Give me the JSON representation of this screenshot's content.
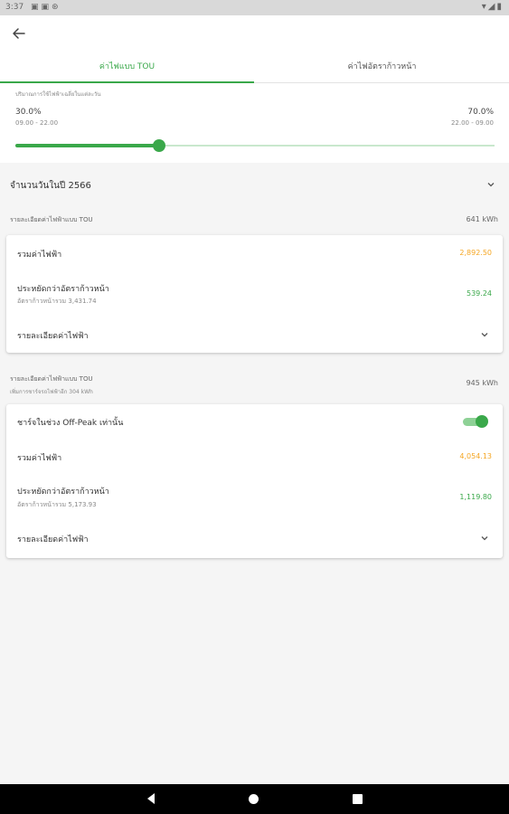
{
  "status_bar": {
    "time": "3:37"
  },
  "tabs": [
    {
      "label": "ค่าไฟแบบ TOU",
      "active": true
    },
    {
      "label": "ค่าไฟอัตราก้าวหน้า",
      "active": false
    }
  ],
  "usage_ratio": {
    "caption": "ปริมาณการใช้ไฟฟ้าเฉลี่ยในแต่ละวัน",
    "peak_percent": "30.0%",
    "peak_hours": "09.00 - 22.00",
    "offpeak_percent": "70.0%",
    "offpeak_hours": "22.00 - 09.00",
    "slider_value": 0.3
  },
  "days_selector": {
    "label": "จำนวนวันในปี 2566"
  },
  "tou_section": {
    "label": "รายละเอียดค่าไฟฟ้าแบบ TOU",
    "kwh": "641 kWh",
    "total_label": "รวมค่าไฟฟ้า",
    "total_value": "2,892.50",
    "saving_label": "ประหยัดกว่าอัตราก้าวหน้า",
    "saving_sub": "อัตราก้าวหน้ารวม 3,431.74",
    "saving_value": "539.24",
    "detail_label": "รายละเอียดค่าไฟฟ้า"
  },
  "ev_section": {
    "label": "รายละเอียดค่าไฟฟ้าแบบ TOU",
    "sub": "เพิ่มการชาร์จรถไฟฟ้าอีก 304 kWh",
    "kwh": "945 kWh",
    "offpeak_toggle_label": "ชาร์จในช่วง Off-Peak เท่านั้น",
    "offpeak_toggle_on": true,
    "total_label": "รวมค่าไฟฟ้า",
    "total_value": "4,054.13",
    "saving_label": "ประหยัดกว่าอัตราก้าวหน้า",
    "saving_sub": "อัตราก้าวหน้ารวม 5,173.93",
    "saving_value": "1,119.80",
    "detail_label": "รายละเอียดค่าไฟฟ้า"
  },
  "colors": {
    "accent": "#3aa84a",
    "cost": "#f5a623"
  }
}
